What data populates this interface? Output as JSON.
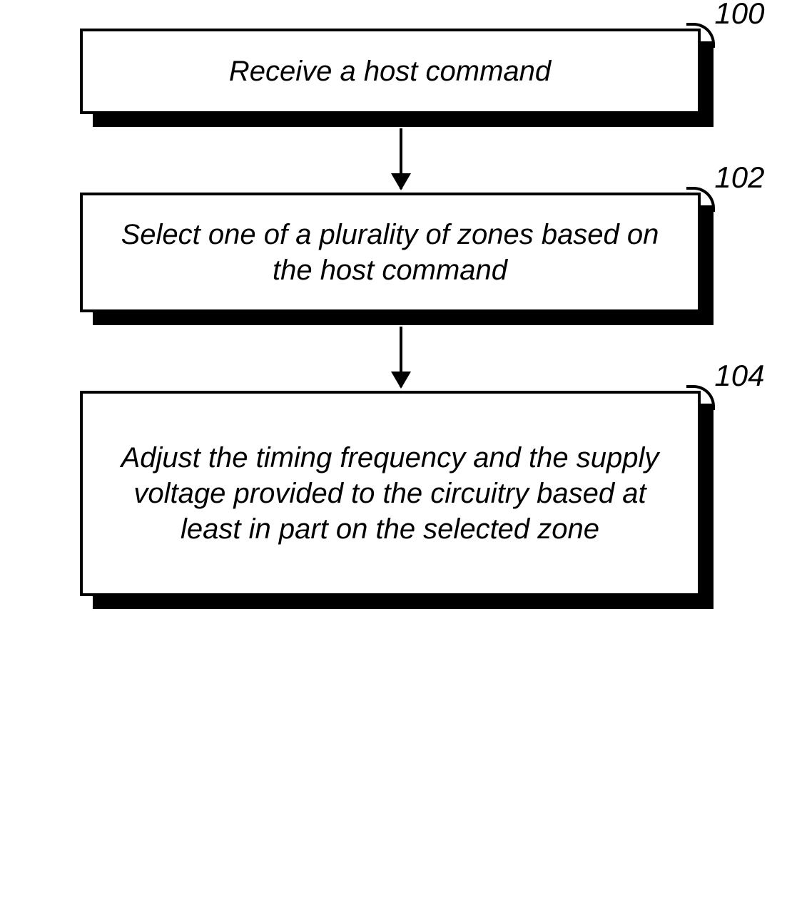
{
  "chart_data": {
    "type": "flowchart",
    "steps": [
      {
        "id": "100",
        "text": "Receive a host command"
      },
      {
        "id": "102",
        "text": "Select one of a plurality of zones based on the host command"
      },
      {
        "id": "104",
        "text": "Adjust the timing frequency and the supply voltage provided to the circuitry based at least in part on the selected zone"
      }
    ],
    "connections": [
      {
        "from": "100",
        "to": "102"
      },
      {
        "from": "102",
        "to": "104"
      }
    ]
  }
}
